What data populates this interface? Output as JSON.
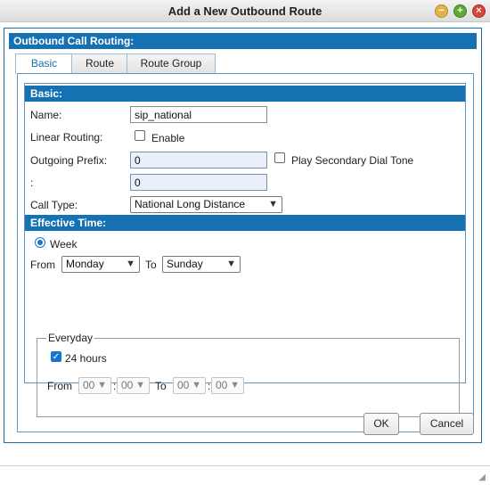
{
  "window": {
    "title": "Add a New Outbound Route",
    "controls": {
      "minimize": "−",
      "maximize": "+",
      "close": "×"
    }
  },
  "panel": {
    "title": "Outbound Call Routing:"
  },
  "tabs": [
    {
      "label": "Basic",
      "active": true
    },
    {
      "label": "Route",
      "active": false
    },
    {
      "label": "Route Group",
      "active": false
    }
  ],
  "basic": {
    "section_title": "Basic:",
    "name_label": "Name:",
    "name_value": "sip_national",
    "linear_routing_label": "Linear Routing:",
    "linear_enable_label": "Enable",
    "linear_enabled": false,
    "outgoing_prefix_label": "Outgoing Prefix:",
    "outgoing_prefix_value": "0",
    "play_secondary_label": "Play Secondary Dial Tone",
    "play_secondary_checked": false,
    "colon_label": ":",
    "colon_value": "0",
    "call_type_label": "Call Type:",
    "call_type_value": "National Long Distance"
  },
  "effective_time": {
    "section_title": "Effective Time:",
    "week_label": "Week",
    "from_label": "From",
    "from_day": "Monday",
    "to_label": "To",
    "to_day": "Sunday",
    "everyday": {
      "legend": "Everyday",
      "hours_label": "24 hours",
      "hours_checked": true,
      "from_label": "From",
      "from_hour": "00",
      "from_min": "00",
      "to_label": "To",
      "to_hour": "00",
      "to_min": "00",
      "time_separator": ":"
    }
  },
  "buttons": {
    "ok": "OK",
    "cancel": "Cancel"
  },
  "icons": {
    "dropdown": "▼",
    "check": "✓",
    "grip": "◢"
  },
  "colors": {
    "accent": "#1671b3",
    "checkbox": "#1b74d3",
    "input_highlight": "#e9f0fb"
  }
}
